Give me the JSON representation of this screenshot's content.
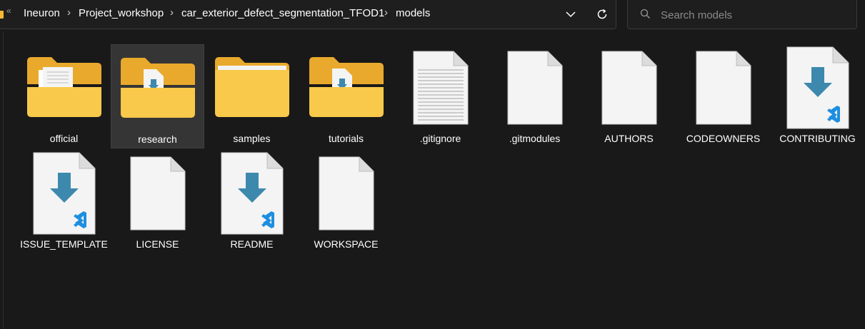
{
  "breadcrumb": {
    "items": [
      "Ineuron",
      "Project_workshop",
      "car_exterior_defect_segmentation_TFOD1",
      "models"
    ]
  },
  "search": {
    "placeholder": "Search models"
  },
  "files": [
    {
      "name": "official",
      "type": "folder-docs"
    },
    {
      "name": "research",
      "type": "folder-vscode"
    },
    {
      "name": "samples",
      "type": "folder-plain"
    },
    {
      "name": "tutorials",
      "type": "folder-vscode"
    },
    {
      "name": ".gitignore",
      "type": "file-text"
    },
    {
      "name": ".gitmodules",
      "type": "file-blank"
    },
    {
      "name": "AUTHORS",
      "type": "file-blank"
    },
    {
      "name": "CODEOWNERS",
      "type": "file-blank"
    },
    {
      "name": "CONTRIBUTING",
      "type": "file-vscode"
    },
    {
      "name": "ISSUE_TEMPLATE",
      "type": "file-vscode"
    },
    {
      "name": "LICENSE",
      "type": "file-blank"
    },
    {
      "name": "README",
      "type": "file-vscode"
    },
    {
      "name": "WORKSPACE",
      "type": "file-blank"
    }
  ],
  "selected": "research",
  "colors": {
    "background": "#191919",
    "selection": "#353535",
    "folder": "#f8c94a",
    "vscode_arrow": "#3d89ad",
    "vscode_logo": "#1e8fe0"
  }
}
